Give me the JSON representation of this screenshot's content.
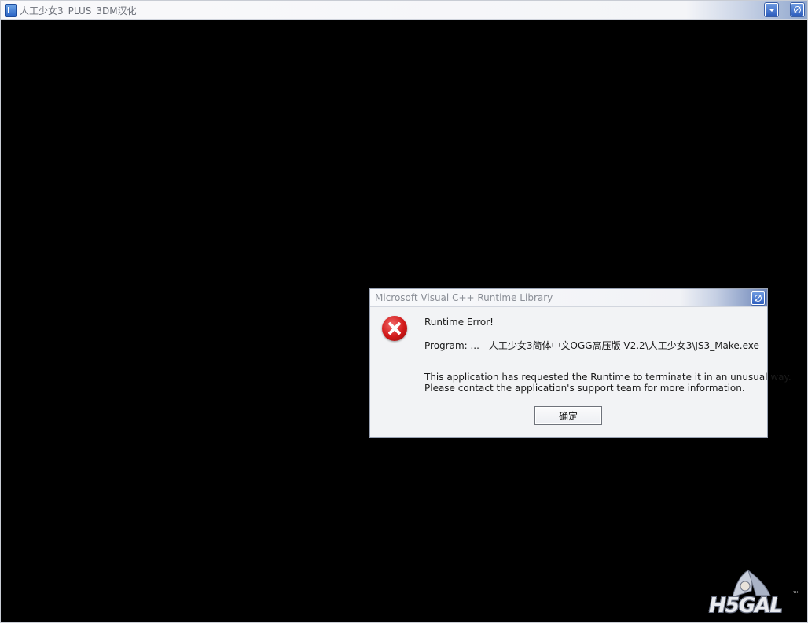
{
  "main_window": {
    "title": "人工少女3_PLUS_3DM汉化",
    "icons": {
      "app": "app-icon",
      "minimize": "minimize-icon",
      "close": "close-icon"
    }
  },
  "dialog": {
    "title": "Microsoft Visual C++ Runtime Library",
    "icon": "error-icon",
    "heading": "Runtime Error!",
    "program_line": "Program: ... - 人工少女3简体中文OGG高压版 V2.2\\人工少女3\\JS3_Make.exe",
    "message_line1": "This application has requested the Runtime to terminate it in an unusual way.",
    "message_line2": "Please contact the application's support team for more information.",
    "ok_label": "确定",
    "colors": {
      "error_red": "#d11818",
      "background": "#f2f3f5"
    }
  },
  "watermark": {
    "text": "H5GAL",
    "tm": "™"
  }
}
